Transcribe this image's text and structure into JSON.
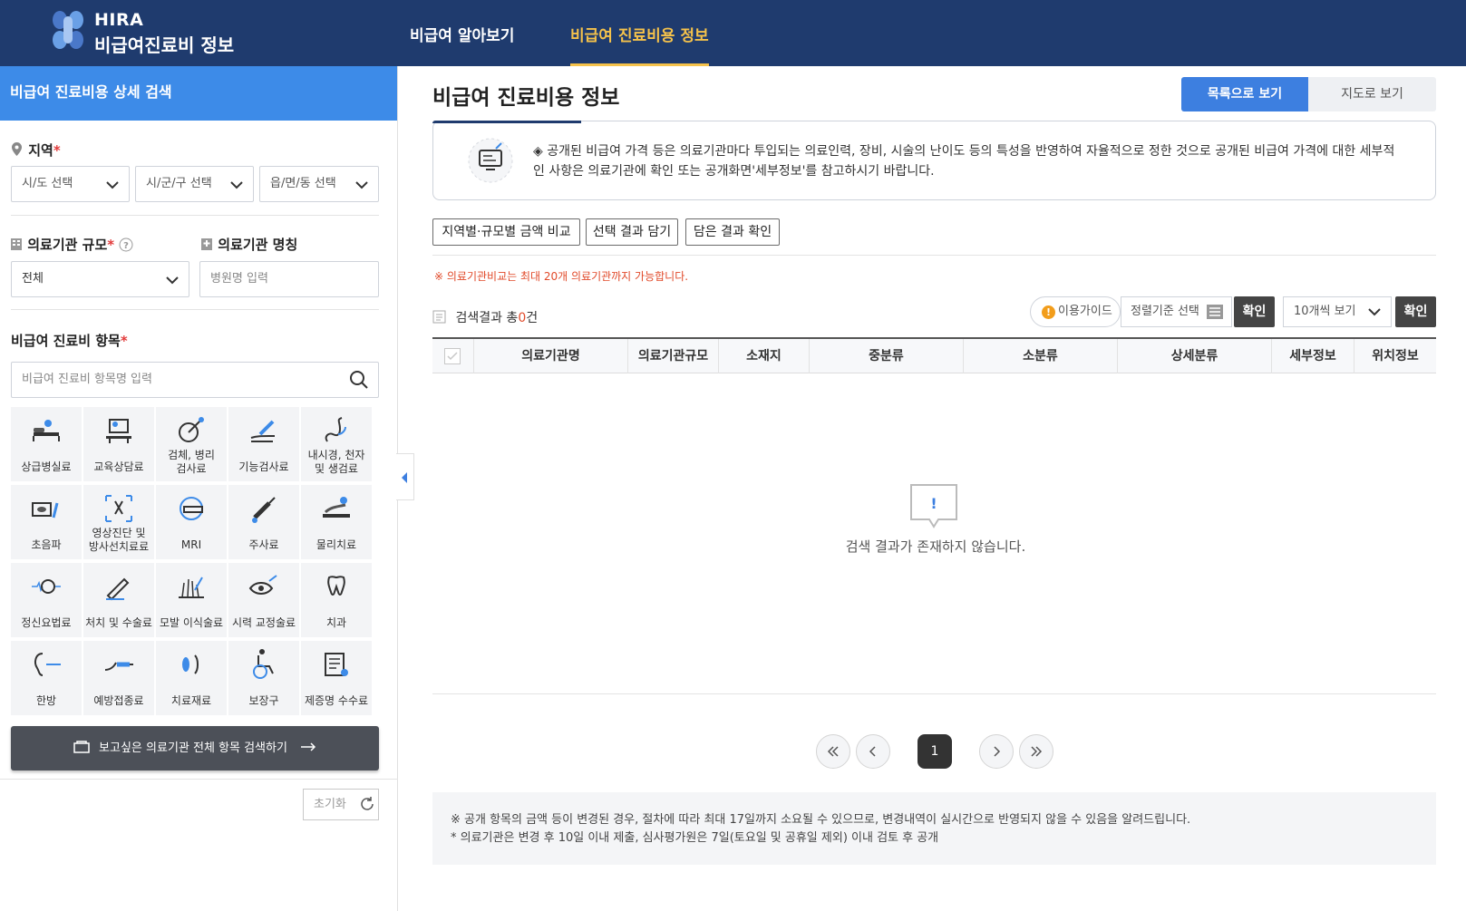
{
  "header": {
    "logo_brand": "HIRA",
    "logo_title": "비급여진료비 정보",
    "nav": [
      "비급여 알아보기",
      "비급여 진료비용 정보"
    ]
  },
  "sidebar": {
    "title": "비급여 진료비용 상세 검색",
    "region": {
      "label": "지역",
      "required": "*",
      "selects": [
        "시/도 선택",
        "시/군/구 선택",
        "읍/면/동 선택"
      ]
    },
    "scale": {
      "label": "의료기관 규모",
      "required": "*",
      "value": "전체"
    },
    "hospital_name": {
      "label": "의료기관 명칭",
      "placeholder": "병원명 입력"
    },
    "items": {
      "label": "비급여 진료비 항목",
      "required": "*",
      "placeholder": "비급여 진료비 항목명 입력"
    },
    "categories": [
      {
        "l1": "상급병실료",
        "l2": "",
        "icon": "bed-icon"
      },
      {
        "l1": "교육상담료",
        "l2": "",
        "icon": "consult-icon"
      },
      {
        "l1": "검체, 병리",
        "l2": "검사료",
        "icon": "specimen-icon"
      },
      {
        "l1": "기능검사료",
        "l2": "",
        "icon": "function-test-icon"
      },
      {
        "l1": "내시경, 천자",
        "l2": "및 생검료",
        "icon": "endoscope-icon"
      },
      {
        "l1": "초음파",
        "l2": "",
        "icon": "ultrasound-icon"
      },
      {
        "l1": "영상진단 및",
        "l2": "방사선치료료",
        "icon": "xray-icon"
      },
      {
        "l1": "MRI",
        "l2": "",
        "icon": "mri-icon"
      },
      {
        "l1": "주사료",
        "l2": "",
        "icon": "syringe-icon"
      },
      {
        "l1": "물리치료",
        "l2": "",
        "icon": "physical-therapy-icon"
      },
      {
        "l1": "정신요법료",
        "l2": "",
        "icon": "brain-icon"
      },
      {
        "l1": "처치 및 수술료",
        "l2": "",
        "icon": "scalpel-icon"
      },
      {
        "l1": "모발 이식술료",
        "l2": "",
        "icon": "hair-icon"
      },
      {
        "l1": "시력 교정술료",
        "l2": "",
        "icon": "eye-icon"
      },
      {
        "l1": "치과",
        "l2": "",
        "icon": "tooth-icon"
      },
      {
        "l1": "한방",
        "l2": "",
        "icon": "acupuncture-icon"
      },
      {
        "l1": "예방접종료",
        "l2": "",
        "icon": "vaccine-icon"
      },
      {
        "l1": "치료재료",
        "l2": "",
        "icon": "material-icon"
      },
      {
        "l1": "보장구",
        "l2": "",
        "icon": "wheelchair-icon"
      },
      {
        "l1": "제증명 수수료",
        "l2": "",
        "icon": "certificate-icon"
      }
    ],
    "search_all_button": "보고싶은 의료기관 전체 항목 검색하기",
    "reset_button": "초기화"
  },
  "main": {
    "title": "비급여 진료비용 정보",
    "view_list": "목록으로 보기",
    "view_map": "지도로 보기",
    "notice": "◈ 공개된 비급여 가격 등은 의료기관마다 투입되는 의료인력, 장비, 시술의 난이도 등의 특성을 반영하여 자율적으로 정한 것으로 공개된 비급여 가격에 대한 세부적인 사항은 의료기관에 확인 또는 공개화면'세부정보'를 참고하시기 바랍니다.",
    "tool_buttons": [
      "지역별·규모별 금액 비교",
      "선택 결과 담기",
      "담은 결과 확인"
    ],
    "warning": "※ 의료기관비교는 최대 20개 의료기관까지 가능합니다.",
    "result_prefix": "검색결과 총",
    "result_count": "0",
    "result_suffix": "건",
    "guide_button": "이용가이드",
    "sort_select": "정렬기준 선택",
    "confirm": "확인",
    "page_size": "10개씩 보기",
    "columns": [
      "의료기관명",
      "의료기관규모",
      "소재지",
      "중분류",
      "소분류",
      "상세분류",
      "세부정보",
      "위치정보"
    ],
    "empty_message": "검색 결과가 존재하지 않습니다.",
    "current_page": "1",
    "footnotes": [
      "※ 공개 항목의 금액 등이 변경된 경우, 절차에 따라 최대 17일까지 소요될 수 있으므로, 변경내역이 실시간으로 반영되지 않을 수 있음을 알려드립니다.",
      "* 의료기관은 변경 후 10일 이내 제출, 심사평가원은 7일(토요일 및 공휴일 제외) 이내 검토 후 공개"
    ]
  },
  "colors": {
    "header_bg": "#1f3b6e",
    "nav_active": "#f5c24b",
    "sidebar_head": "#3d8be8",
    "primary_button": "#3d7fe0",
    "warning_text": "#e14a2a"
  }
}
